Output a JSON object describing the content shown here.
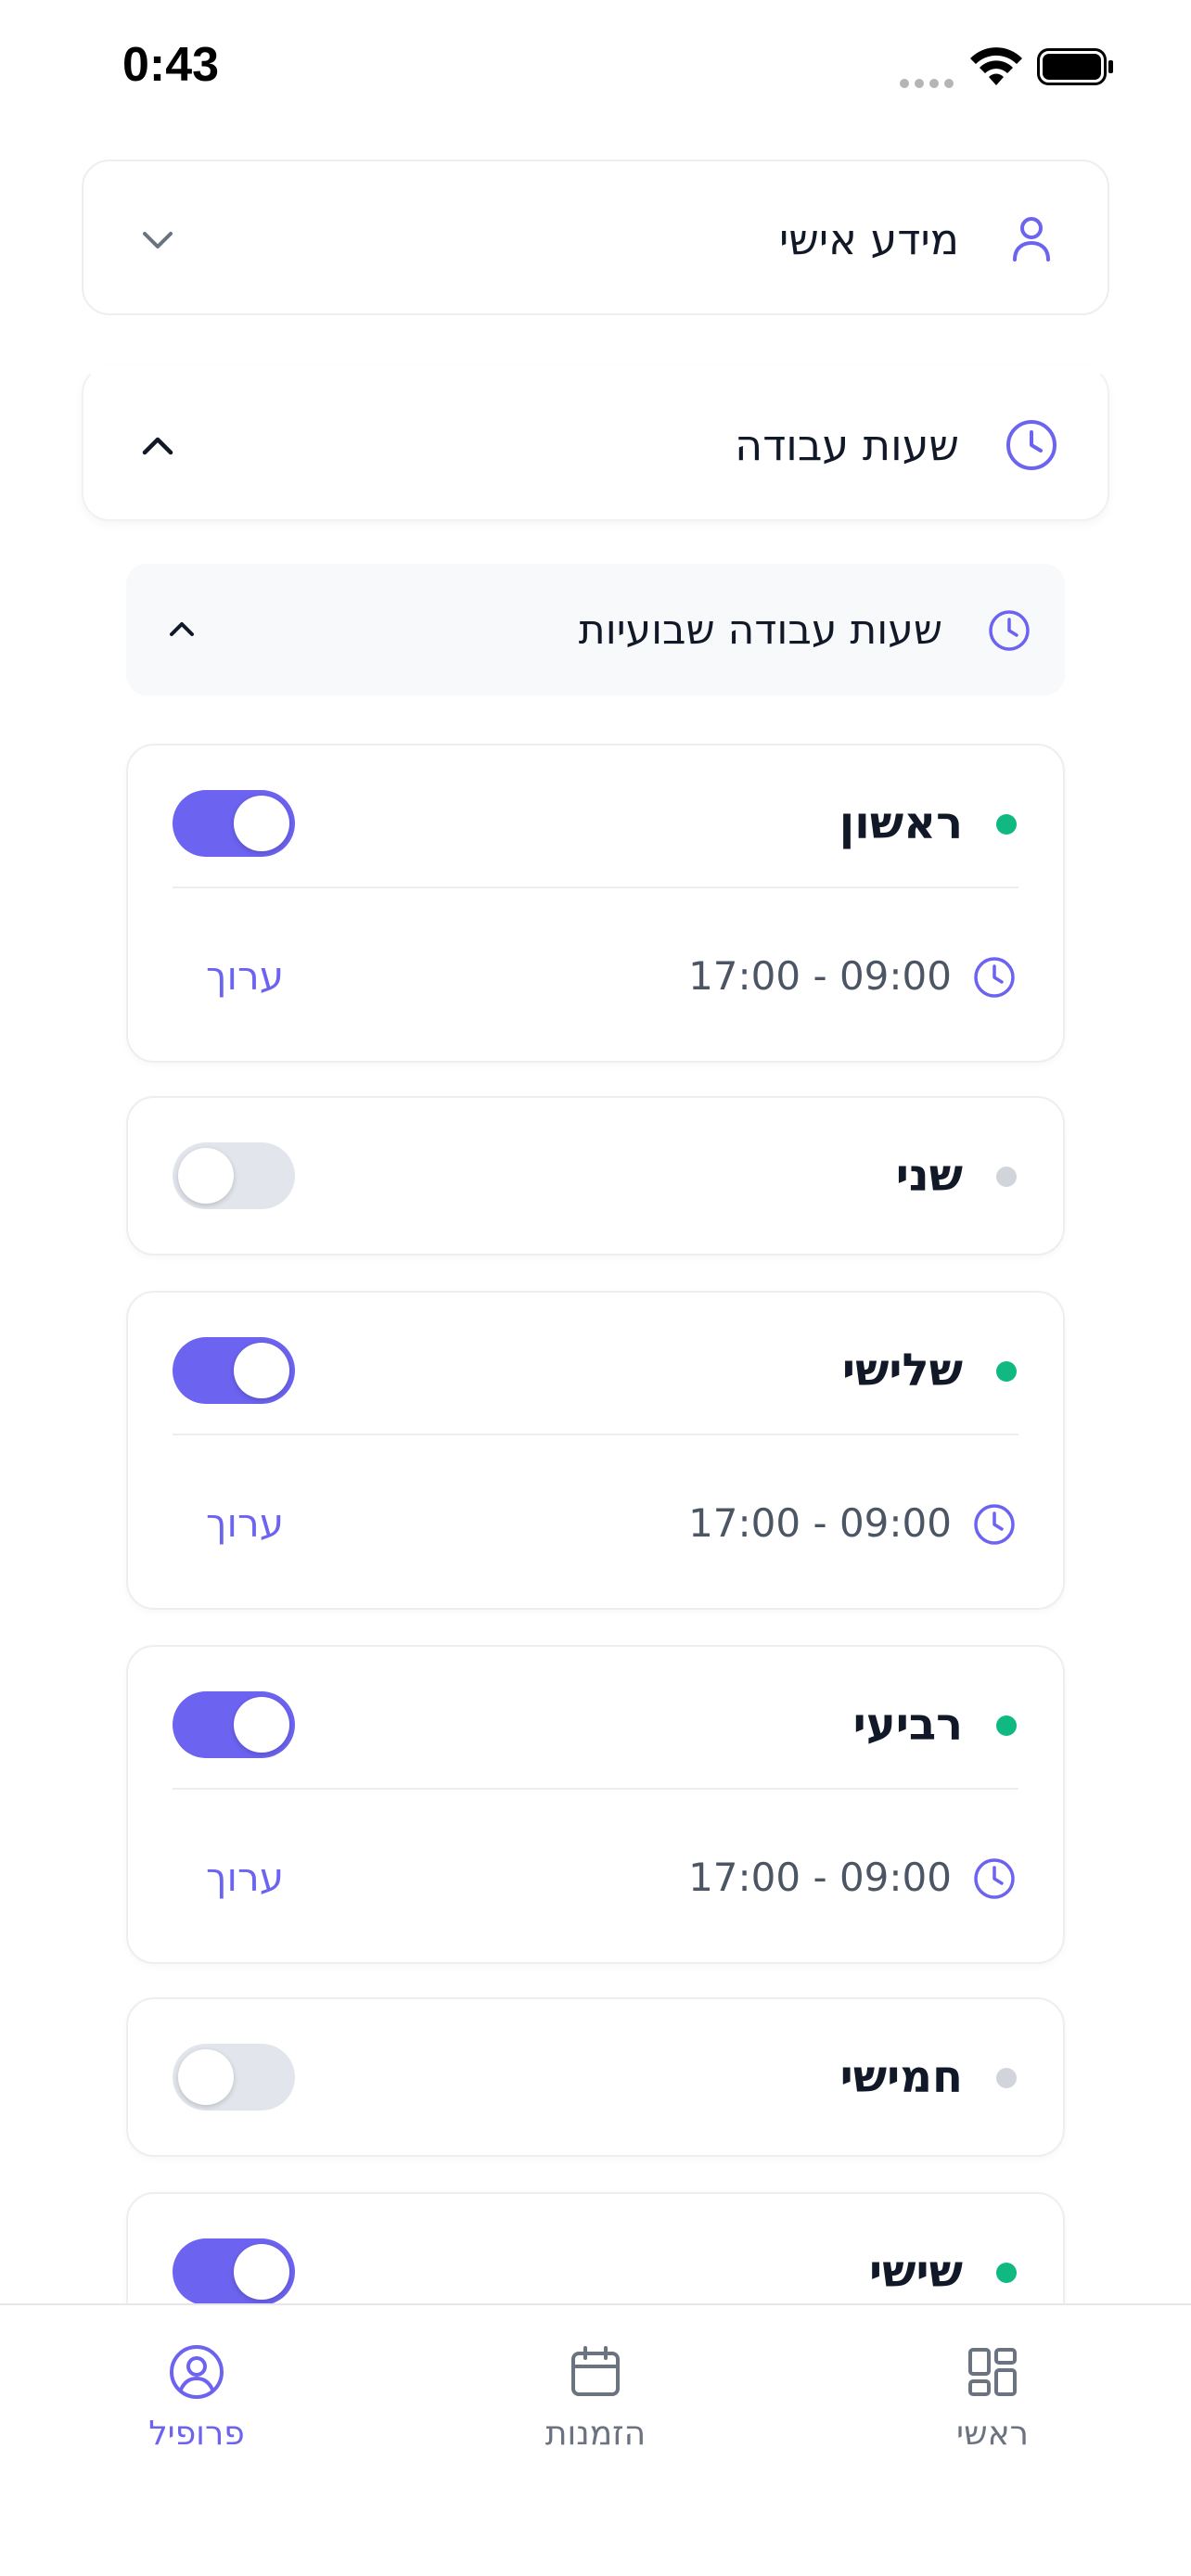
{
  "status_bar": {
    "time": "0:43"
  },
  "sections": {
    "personal_info": {
      "title": "מידע אישי",
      "icon": "user-icon",
      "expanded": false
    },
    "work_hours": {
      "title": "שעות עבודה",
      "icon": "clock-icon",
      "expanded": true
    }
  },
  "weekly": {
    "title": "שעות עבודה שבועיות",
    "icon": "clock-icon",
    "expanded": true
  },
  "days": [
    {
      "name": "ראשון",
      "enabled": true,
      "hours": "17:00 - 09:00",
      "edit_label": "ערוך"
    },
    {
      "name": "שני",
      "enabled": false
    },
    {
      "name": "שלישי",
      "enabled": true,
      "hours": "17:00 - 09:00",
      "edit_label": "ערוך"
    },
    {
      "name": "רביעי",
      "enabled": true,
      "hours": "17:00 - 09:00",
      "edit_label": "ערוך"
    },
    {
      "name": "חמישי",
      "enabled": false
    },
    {
      "name": "שישי",
      "enabled": true
    }
  ],
  "colors": {
    "accent": "#6c63f0",
    "active_dot": "#10b981",
    "inactive_dot": "#d1d5db",
    "nav_inactive": "#6b7280"
  },
  "bottom_nav": [
    {
      "label": "פרופיל",
      "icon": "profile-icon",
      "active": true
    },
    {
      "label": "הזמנות",
      "icon": "calendar-icon",
      "active": false
    },
    {
      "label": "ראשי",
      "icon": "grid-icon",
      "active": false
    }
  ]
}
